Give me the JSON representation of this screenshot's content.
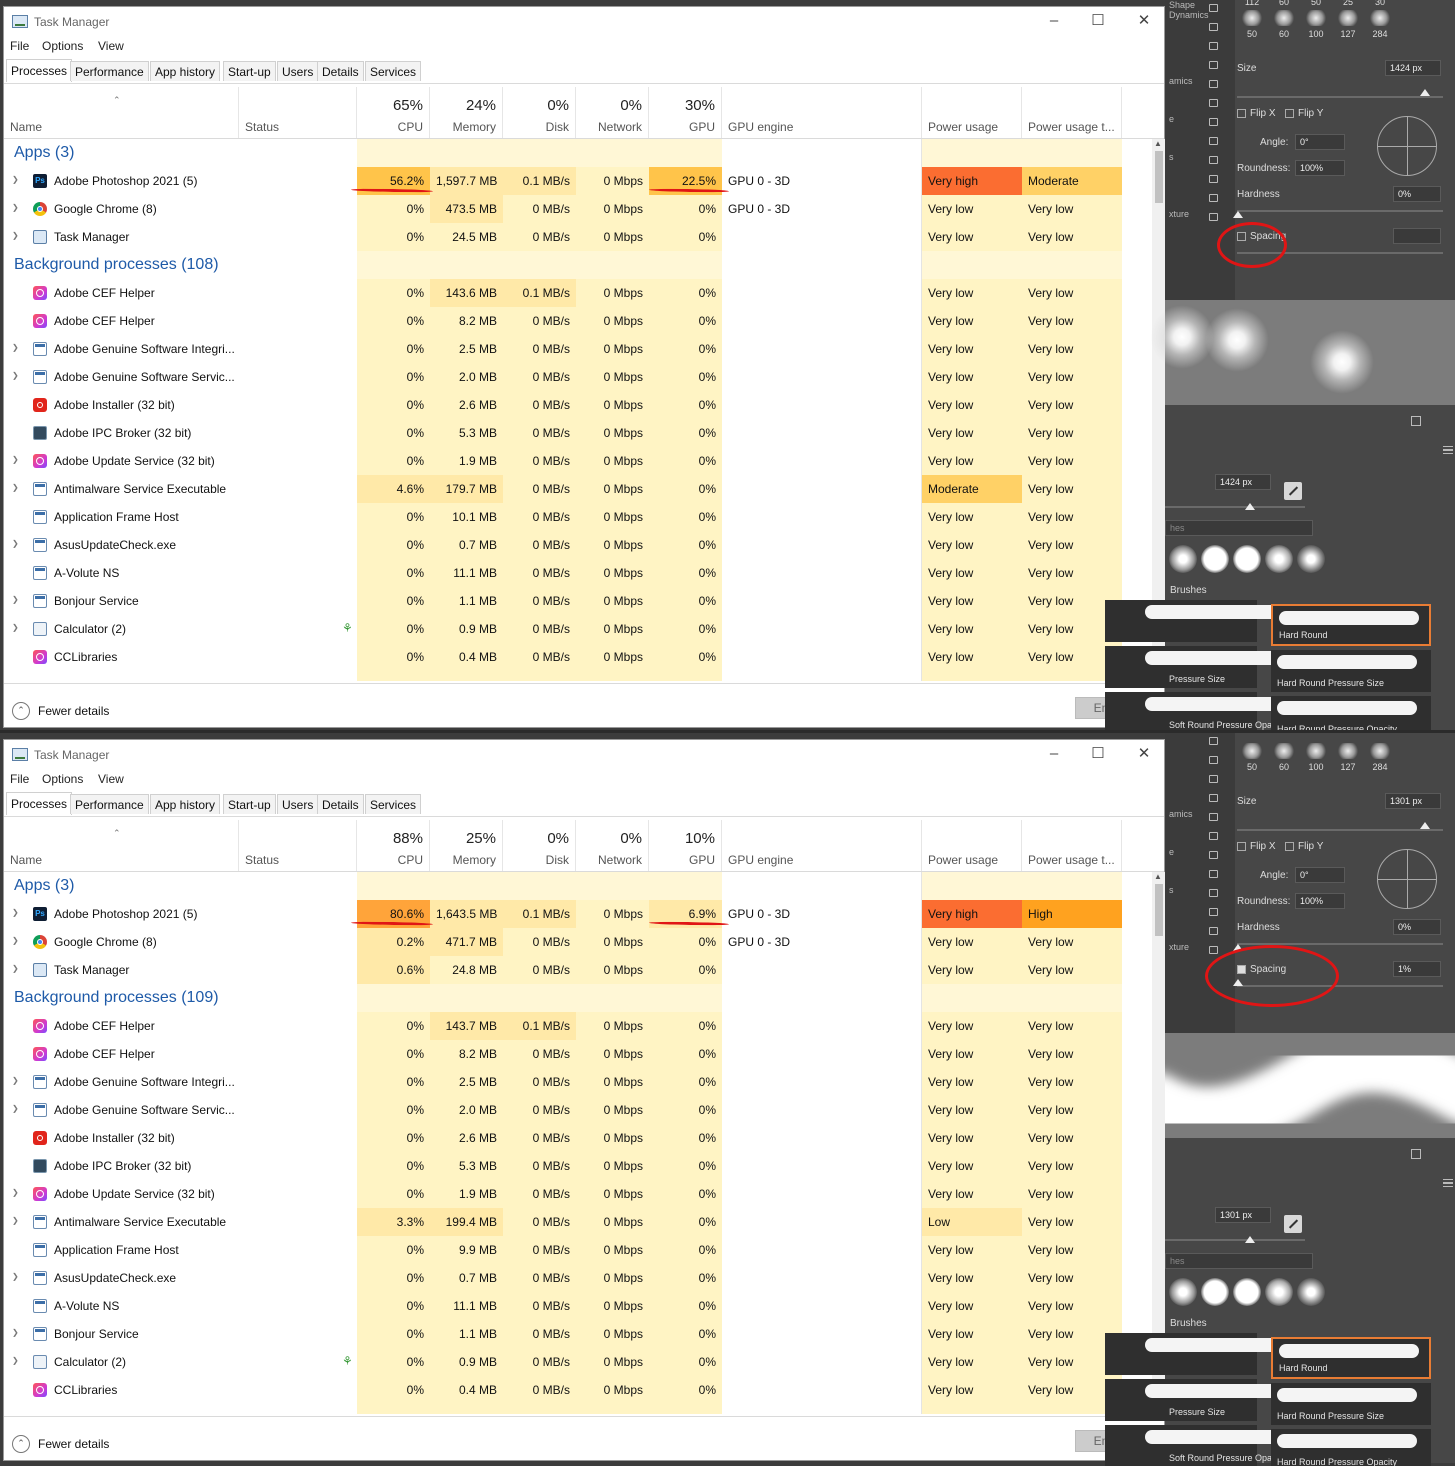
{
  "screens": [
    {
      "window_title": "Task Manager",
      "menu": [
        "File",
        "Options",
        "View"
      ],
      "tabs": [
        "Processes",
        "Performance",
        "App history",
        "Start-up",
        "Users",
        "Details",
        "Services"
      ],
      "header": {
        "name": "Name",
        "status": "Status",
        "cpu_pct": "65%",
        "cpu": "CPU",
        "mem_pct": "24%",
        "mem": "Memory",
        "disk_pct": "0%",
        "disk": "Disk",
        "net_pct": "0%",
        "net": "Network",
        "gpu_pct": "30%",
        "gpu": "GPU",
        "gpu_engine": "GPU engine",
        "power": "Power usage",
        "power_trend": "Power usage t..."
      },
      "apps_group": "Apps (3)",
      "bg_group": "Background processes (108)",
      "apps": [
        {
          "icon": "photoshop-icon",
          "name": "Adobe Photoshop 2021 (5)",
          "expand": true,
          "cpu": "56.2%",
          "mem": "1,597.7 MB",
          "disk": "0.1 MB/s",
          "net": "0 Mbps",
          "gpu": "22.5%",
          "engine": "GPU 0 - 3D",
          "power": "Very high",
          "trend": "Moderate"
        },
        {
          "icon": "chrome-icon",
          "name": "Google Chrome (8)",
          "expand": true,
          "cpu": "0%",
          "mem": "473.5 MB",
          "disk": "0 MB/s",
          "net": "0 Mbps",
          "gpu": "0%",
          "engine": "GPU 0 - 3D",
          "power": "Very low",
          "trend": "Very low"
        },
        {
          "icon": "task-manager-icon",
          "name": "Task Manager",
          "expand": true,
          "cpu": "0%",
          "mem": "24.5 MB",
          "disk": "0 MB/s",
          "net": "0 Mbps",
          "gpu": "0%",
          "engine": "",
          "power": "Very low",
          "trend": "Very low"
        }
      ],
      "background": [
        {
          "icon": "creative-cloud-icon",
          "name": "Adobe CEF Helper",
          "expand": false,
          "cpu": "0%",
          "mem": "143.6 MB",
          "disk": "0.1 MB/s",
          "net": "0 Mbps",
          "gpu": "0%",
          "power": "Very low",
          "trend": "Very low"
        },
        {
          "icon": "creative-cloud-icon",
          "name": "Adobe CEF Helper",
          "expand": false,
          "cpu": "0%",
          "mem": "8.2 MB",
          "disk": "0 MB/s",
          "net": "0 Mbps",
          "gpu": "0%",
          "power": "Very low",
          "trend": "Very low"
        },
        {
          "icon": "window-icon",
          "name": "Adobe Genuine Software Integri...",
          "expand": true,
          "cpu": "0%",
          "mem": "2.5 MB",
          "disk": "0 MB/s",
          "net": "0 Mbps",
          "gpu": "0%",
          "power": "Very low",
          "trend": "Very low"
        },
        {
          "icon": "window-icon",
          "name": "Adobe Genuine Software Servic...",
          "expand": true,
          "cpu": "0%",
          "mem": "2.0 MB",
          "disk": "0 MB/s",
          "net": "0 Mbps",
          "gpu": "0%",
          "power": "Very low",
          "trend": "Very low"
        },
        {
          "icon": "adobe-installer-icon",
          "name": "Adobe Installer (32 bit)",
          "expand": false,
          "cpu": "0%",
          "mem": "2.6 MB",
          "disk": "0 MB/s",
          "net": "0 Mbps",
          "gpu": "0%",
          "power": "Very low",
          "trend": "Very low"
        },
        {
          "icon": "ipc-broker-icon",
          "name": "Adobe IPC Broker (32 bit)",
          "expand": false,
          "cpu": "0%",
          "mem": "5.3 MB",
          "disk": "0 MB/s",
          "net": "0 Mbps",
          "gpu": "0%",
          "power": "Very low",
          "trend": "Very low"
        },
        {
          "icon": "creative-cloud-icon",
          "name": "Adobe Update Service (32 bit)",
          "expand": true,
          "cpu": "0%",
          "mem": "1.9 MB",
          "disk": "0 MB/s",
          "net": "0 Mbps",
          "gpu": "0%",
          "power": "Very low",
          "trend": "Very low"
        },
        {
          "icon": "window-icon",
          "name": "Antimalware Service Executable",
          "expand": true,
          "cpu": "4.6%",
          "mem": "179.7 MB",
          "disk": "0 MB/s",
          "net": "0 Mbps",
          "gpu": "0%",
          "power": "Moderate",
          "trend": "Very low"
        },
        {
          "icon": "window-icon",
          "name": "Application Frame Host",
          "expand": false,
          "cpu": "0%",
          "mem": "10.1 MB",
          "disk": "0 MB/s",
          "net": "0 Mbps",
          "gpu": "0%",
          "power": "Very low",
          "trend": "Very low"
        },
        {
          "icon": "window-icon",
          "name": "AsusUpdateCheck.exe",
          "expand": true,
          "cpu": "0%",
          "mem": "0.7 MB",
          "disk": "0 MB/s",
          "net": "0 Mbps",
          "gpu": "0%",
          "power": "Very low",
          "trend": "Very low"
        },
        {
          "icon": "window-icon",
          "name": "A-Volute NS",
          "expand": false,
          "cpu": "0%",
          "mem": "11.1 MB",
          "disk": "0 MB/s",
          "net": "0 Mbps",
          "gpu": "0%",
          "power": "Very low",
          "trend": "Very low"
        },
        {
          "icon": "window-icon",
          "name": "Bonjour Service",
          "expand": true,
          "cpu": "0%",
          "mem": "1.1 MB",
          "disk": "0 MB/s",
          "net": "0 Mbps",
          "gpu": "0%",
          "power": "Very low",
          "trend": "Very low"
        },
        {
          "icon": "calculator-icon",
          "name": "Calculator (2)",
          "expand": true,
          "leaf": true,
          "cpu": "0%",
          "mem": "0.9 MB",
          "disk": "0 MB/s",
          "net": "0 Mbps",
          "gpu": "0%",
          "power": "Very low",
          "trend": "Very low"
        },
        {
          "icon": "creative-cloud-icon",
          "name": "CCLibraries",
          "expand": false,
          "cpu": "0%",
          "mem": "0.4 MB",
          "disk": "0 MB/s",
          "net": "0 Mbps",
          "gpu": "0%",
          "power": "Very low",
          "trend": "Very low"
        }
      ],
      "footer": {
        "fewer": "Fewer details",
        "end_task": "End task"
      },
      "photoshop": {
        "strip_labels": [
          "Shape Dynamics",
          "amics",
          "e",
          "s",
          "xture"
        ],
        "tip_numbers_top": [
          "112",
          "60",
          "50",
          "25",
          "30"
        ],
        "tip_numbers": [
          "50",
          "60",
          "100",
          "127",
          "284"
        ],
        "size_label": "Size",
        "size_value": "1424 px",
        "flip_x": "Flip X",
        "flip_y": "Flip Y",
        "angle_label": "Angle:",
        "angle_value": "0°",
        "roundness_label": "Roundness:",
        "roundness_value": "100%",
        "hardness_label": "Hardness",
        "hardness_value": "0%",
        "spacing_label": "Spacing",
        "spacing_checked": false,
        "spacing_value": "",
        "preview": "dots",
        "size2_value": "1424 px",
        "brushes_partial": "hes",
        "group_label": "Brushes",
        "brush_names": [
          "Hard Round",
          "Pressure Size",
          "Hard Round Pressure Size",
          "Soft Round Pressure Opacity",
          "Hard Round Pressure Opacity"
        ]
      }
    },
    {
      "window_title": "Task Manager",
      "menu": [
        "File",
        "Options",
        "View"
      ],
      "tabs": [
        "Processes",
        "Performance",
        "App history",
        "Start-up",
        "Users",
        "Details",
        "Services"
      ],
      "header": {
        "name": "Name",
        "status": "Status",
        "cpu_pct": "88%",
        "cpu": "CPU",
        "mem_pct": "25%",
        "mem": "Memory",
        "disk_pct": "0%",
        "disk": "Disk",
        "net_pct": "0%",
        "net": "Network",
        "gpu_pct": "10%",
        "gpu": "GPU",
        "gpu_engine": "GPU engine",
        "power": "Power usage",
        "power_trend": "Power usage t..."
      },
      "apps_group": "Apps (3)",
      "bg_group": "Background processes (109)",
      "apps": [
        {
          "icon": "photoshop-icon",
          "name": "Adobe Photoshop 2021 (5)",
          "expand": true,
          "cpu": "80.6%",
          "mem": "1,643.5 MB",
          "disk": "0.1 MB/s",
          "net": "0 Mbps",
          "gpu": "6.9%",
          "engine": "GPU 0 - 3D",
          "power": "Very high",
          "trend": "High"
        },
        {
          "icon": "chrome-icon",
          "name": "Google Chrome (8)",
          "expand": true,
          "cpu": "0.2%",
          "mem": "471.7 MB",
          "disk": "0 MB/s",
          "net": "0 Mbps",
          "gpu": "0%",
          "engine": "GPU 0 - 3D",
          "power": "Very low",
          "trend": "Very low"
        },
        {
          "icon": "task-manager-icon",
          "name": "Task Manager",
          "expand": true,
          "cpu": "0.6%",
          "mem": "24.8 MB",
          "disk": "0 MB/s",
          "net": "0 Mbps",
          "gpu": "0%",
          "engine": "",
          "power": "Very low",
          "trend": "Very low"
        }
      ],
      "background": [
        {
          "icon": "creative-cloud-icon",
          "name": "Adobe CEF Helper",
          "expand": false,
          "cpu": "0%",
          "mem": "143.7 MB",
          "disk": "0.1 MB/s",
          "net": "0 Mbps",
          "gpu": "0%",
          "power": "Very low",
          "trend": "Very low"
        },
        {
          "icon": "creative-cloud-icon",
          "name": "Adobe CEF Helper",
          "expand": false,
          "cpu": "0%",
          "mem": "8.2 MB",
          "disk": "0 MB/s",
          "net": "0 Mbps",
          "gpu": "0%",
          "power": "Very low",
          "trend": "Very low"
        },
        {
          "icon": "window-icon",
          "name": "Adobe Genuine Software Integri...",
          "expand": true,
          "cpu": "0%",
          "mem": "2.5 MB",
          "disk": "0 MB/s",
          "net": "0 Mbps",
          "gpu": "0%",
          "power": "Very low",
          "trend": "Very low"
        },
        {
          "icon": "window-icon",
          "name": "Adobe Genuine Software Servic...",
          "expand": true,
          "cpu": "0%",
          "mem": "2.0 MB",
          "disk": "0 MB/s",
          "net": "0 Mbps",
          "gpu": "0%",
          "power": "Very low",
          "trend": "Very low"
        },
        {
          "icon": "adobe-installer-icon",
          "name": "Adobe Installer (32 bit)",
          "expand": false,
          "cpu": "0%",
          "mem": "2.6 MB",
          "disk": "0 MB/s",
          "net": "0 Mbps",
          "gpu": "0%",
          "power": "Very low",
          "trend": "Very low"
        },
        {
          "icon": "ipc-broker-icon",
          "name": "Adobe IPC Broker (32 bit)",
          "expand": false,
          "cpu": "0%",
          "mem": "5.3 MB",
          "disk": "0 MB/s",
          "net": "0 Mbps",
          "gpu": "0%",
          "power": "Very low",
          "trend": "Very low"
        },
        {
          "icon": "creative-cloud-icon",
          "name": "Adobe Update Service (32 bit)",
          "expand": true,
          "cpu": "0%",
          "mem": "1.9 MB",
          "disk": "0 MB/s",
          "net": "0 Mbps",
          "gpu": "0%",
          "power": "Very low",
          "trend": "Very low"
        },
        {
          "icon": "window-icon",
          "name": "Antimalware Service Executable",
          "expand": true,
          "cpu": "3.3%",
          "mem": "199.4 MB",
          "disk": "0 MB/s",
          "net": "0 Mbps",
          "gpu": "0%",
          "power": "Low",
          "trend": "Very low"
        },
        {
          "icon": "window-icon",
          "name": "Application Frame Host",
          "expand": false,
          "cpu": "0%",
          "mem": "9.9 MB",
          "disk": "0 MB/s",
          "net": "0 Mbps",
          "gpu": "0%",
          "power": "Very low",
          "trend": "Very low"
        },
        {
          "icon": "window-icon",
          "name": "AsusUpdateCheck.exe",
          "expand": true,
          "cpu": "0%",
          "mem": "0.7 MB",
          "disk": "0 MB/s",
          "net": "0 Mbps",
          "gpu": "0%",
          "power": "Very low",
          "trend": "Very low"
        },
        {
          "icon": "window-icon",
          "name": "A-Volute NS",
          "expand": false,
          "cpu": "0%",
          "mem": "11.1 MB",
          "disk": "0 MB/s",
          "net": "0 Mbps",
          "gpu": "0%",
          "power": "Very low",
          "trend": "Very low"
        },
        {
          "icon": "window-icon",
          "name": "Bonjour Service",
          "expand": true,
          "cpu": "0%",
          "mem": "1.1 MB",
          "disk": "0 MB/s",
          "net": "0 Mbps",
          "gpu": "0%",
          "power": "Very low",
          "trend": "Very low"
        },
        {
          "icon": "calculator-icon",
          "name": "Calculator (2)",
          "expand": true,
          "leaf": true,
          "cpu": "0%",
          "mem": "0.9 MB",
          "disk": "0 MB/s",
          "net": "0 Mbps",
          "gpu": "0%",
          "power": "Very low",
          "trend": "Very low"
        },
        {
          "icon": "creative-cloud-icon",
          "name": "CCLibraries",
          "expand": false,
          "cpu": "0%",
          "mem": "0.4 MB",
          "disk": "0 MB/s",
          "net": "0 Mbps",
          "gpu": "0%",
          "power": "Very low",
          "trend": "Very low"
        }
      ],
      "footer": {
        "fewer": "Fewer details",
        "end_task": "End task"
      },
      "photoshop": {
        "strip_labels": [
          "",
          "amics",
          "e",
          "s",
          "xture"
        ],
        "tip_numbers_top": [
          "",
          "",
          "",
          "",
          ""
        ],
        "tip_numbers": [
          "50",
          "60",
          "100",
          "127",
          "284"
        ],
        "size_label": "Size",
        "size_value": "1301 px",
        "flip_x": "Flip X",
        "flip_y": "Flip Y",
        "angle_label": "Angle:",
        "angle_value": "0°",
        "roundness_label": "Roundness:",
        "roundness_value": "100%",
        "hardness_label": "Hardness",
        "hardness_value": "0%",
        "spacing_label": "Spacing",
        "spacing_checked": true,
        "spacing_value": "1%",
        "preview": "stroke",
        "size2_value": "1301 px",
        "brushes_partial": "hes",
        "group_label": "Brushes",
        "brush_names": [
          "Hard Round",
          "Pressure Size",
          "Hard Round Pressure Size",
          "Soft Round Pressure Opacity",
          "Hard Round Pressure Opacity"
        ]
      }
    }
  ],
  "colors": {
    "heat_light": "#fff4c4",
    "heat_mid": "#ffe9a8",
    "heat_orange": "#ffc44a",
    "heat_deep": "#ffa43a",
    "power_veryhigh": "#fb6d31",
    "power_moderate": "#ffd166",
    "power_high": "#ffa21f",
    "group_blue": "#1e5aa8",
    "annotation_red": "#e01515",
    "ps_selected": "#e87c34"
  }
}
